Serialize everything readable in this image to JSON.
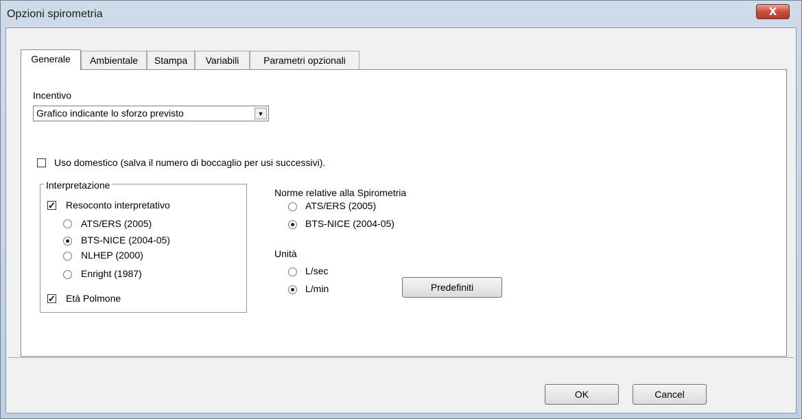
{
  "window": {
    "title": "Opzioni spirometria",
    "close_glyph": "X"
  },
  "tabs": [
    {
      "label": "Generale"
    },
    {
      "label": "Ambientale"
    },
    {
      "label": "Stampa"
    },
    {
      "label": "Variabili"
    },
    {
      "label": "Parametri opzionali"
    }
  ],
  "incentivo": {
    "label": "Incentivo",
    "selected": "Grafico indicante lo sforzo previsto"
  },
  "uso_domestico": {
    "label": "Uso domestico (salva il numero di boccaglio per usi successivi).",
    "checked": false
  },
  "interpretazione": {
    "title": "Interpretazione",
    "resoconto": {
      "label": "Resoconto interpretativo",
      "checked": true
    },
    "options": [
      {
        "label": "ATS/ERS (2005)",
        "selected": false
      },
      {
        "label": "BTS-NICE (2004-05)",
        "selected": true
      },
      {
        "label": "NLHEP (2000)",
        "selected": false
      },
      {
        "label": "Enright (1987)",
        "selected": false
      }
    ],
    "eta_polmone": {
      "label": "Età Polmone",
      "checked": true
    }
  },
  "norme": {
    "title": "Norme relative alla Spirometria",
    "options": [
      {
        "label": "ATS/ERS (2005)",
        "selected": false
      },
      {
        "label": "BTS-NICE (2004-05)",
        "selected": true
      }
    ]
  },
  "unita": {
    "title": "Unità",
    "options": [
      {
        "label": "L/sec",
        "selected": false
      },
      {
        "label": "L/min",
        "selected": true
      }
    ]
  },
  "buttons": {
    "predefiniti": "Predefiniti",
    "ok": "OK",
    "cancel": "Cancel"
  },
  "icons": {
    "check_glyph": "✓"
  }
}
